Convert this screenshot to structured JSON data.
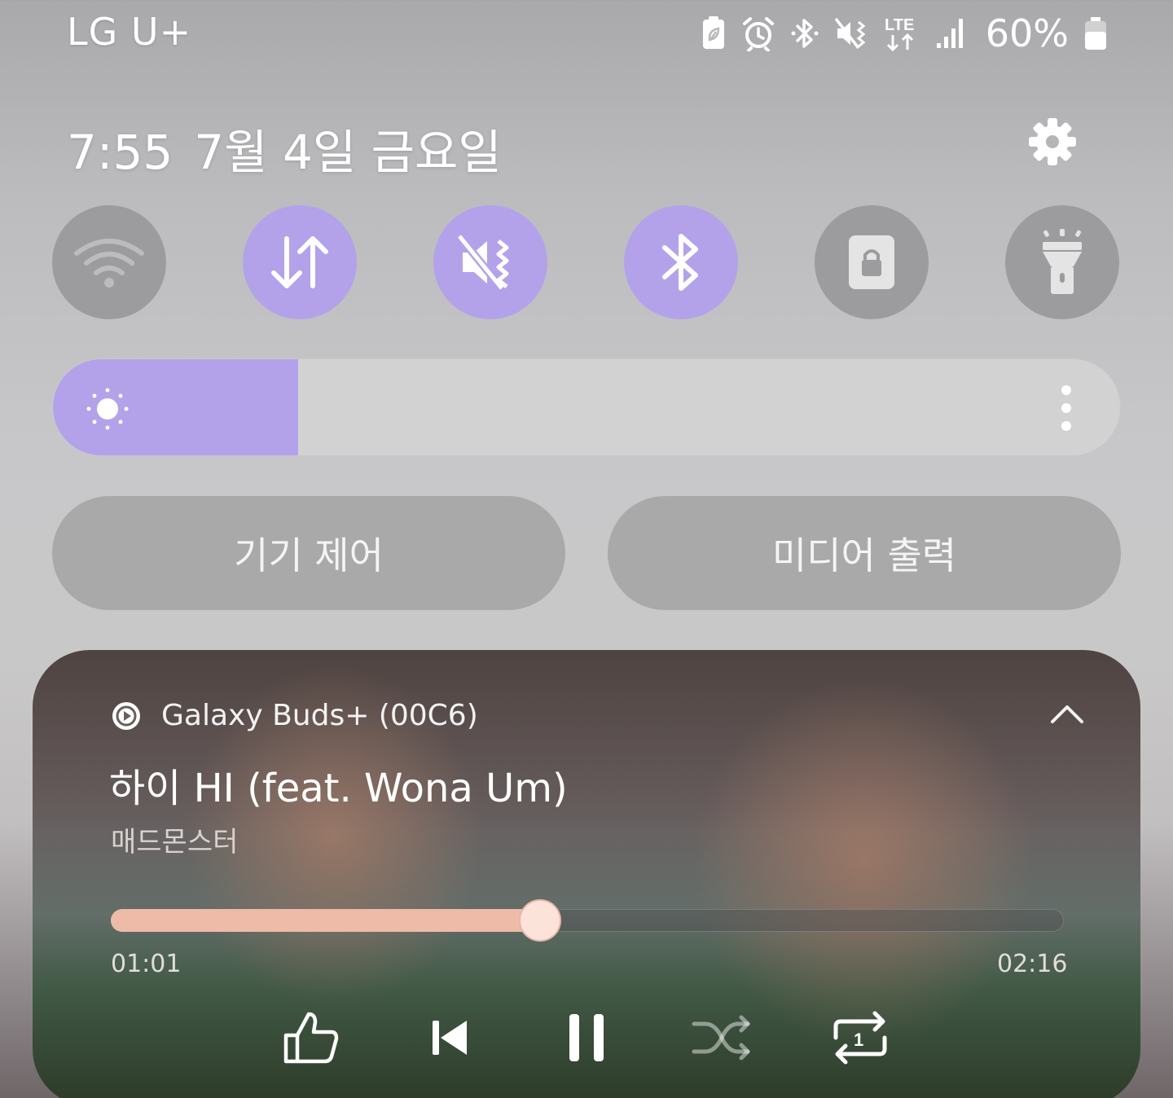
{
  "status_bar": {
    "carrier": "LG U+",
    "icons": [
      "battery-saver-icon",
      "alarm-icon",
      "bluetooth-icon",
      "vibrate-mute-icon",
      "lte-icon",
      "signal-icon"
    ],
    "network_type": "LTE",
    "battery_percent": "60%"
  },
  "header": {
    "time": "7:55",
    "date": "7월 4일 금요일",
    "settings_icon": "gear-icon"
  },
  "quick_toggles": [
    {
      "name": "wifi",
      "icon": "wifi-icon",
      "state": "off"
    },
    {
      "name": "mobile-data",
      "icon": "data-transfer-icon",
      "state": "on"
    },
    {
      "name": "sound",
      "icon": "vibrate-mute-icon",
      "state": "on"
    },
    {
      "name": "bluetooth",
      "icon": "bluetooth-icon",
      "state": "on"
    },
    {
      "name": "rotation-lock",
      "icon": "lock-icon",
      "state": "off"
    },
    {
      "name": "flashlight",
      "icon": "flashlight-icon",
      "state": "off"
    }
  ],
  "brightness": {
    "level": 0.23,
    "icon": "sun-icon",
    "more_icon": "more-vertical-icon"
  },
  "buttons": {
    "device_control": "기기 제어",
    "media_output": "미디어 출력"
  },
  "media": {
    "source": "Galaxy Buds+ (00C6)",
    "title": "하이 HI (feat. Wona Um)",
    "artist": "매드몬스터",
    "elapsed": "01:01",
    "total": "02:16",
    "progress": 0.45,
    "controls": [
      "like-icon",
      "previous-icon",
      "pause-icon",
      "shuffle-icon",
      "repeat-one-icon"
    ]
  },
  "colors": {
    "accent": "#b3a2ea",
    "toggle_off": "#9c9c9e",
    "progress_fill": "#eebba8"
  }
}
